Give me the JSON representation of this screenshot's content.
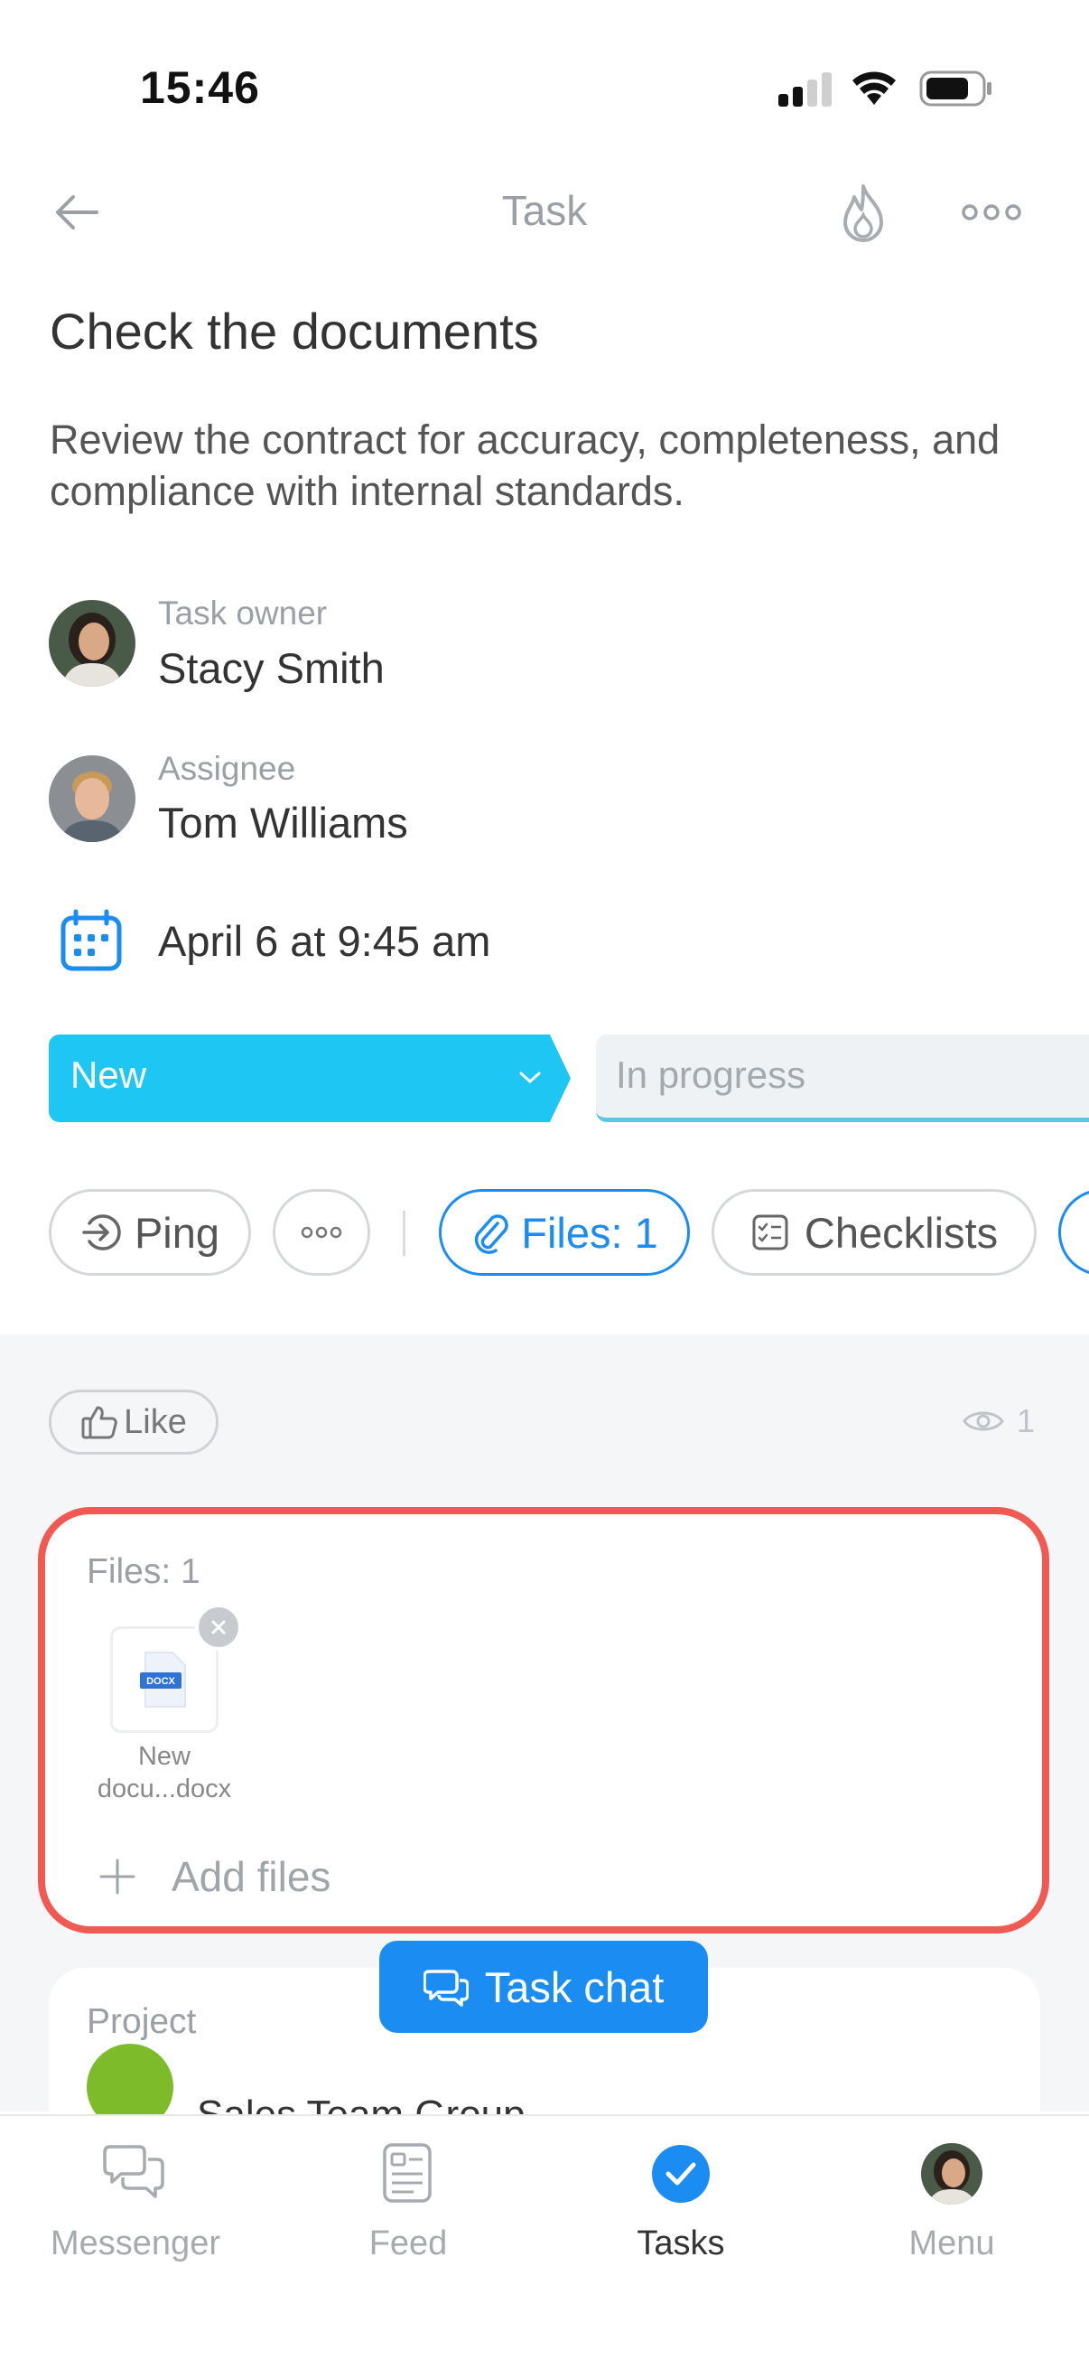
{
  "status_bar": {
    "time": "15:46"
  },
  "header": {
    "title": "Task",
    "back_icon": "arrow-left-icon",
    "fire_icon": "flame-icon",
    "more_icon": "more-horizontal-icon"
  },
  "task": {
    "title": "Check the documents",
    "description": "Review the contract for accuracy, completeness, and compliance with internal standards."
  },
  "owner": {
    "label": "Task owner",
    "name": "Stacy Smith"
  },
  "assignee": {
    "label": "Assignee",
    "name": "Tom Williams"
  },
  "deadline": {
    "text": "April 6 at 9:45 am"
  },
  "stages": {
    "current": "New",
    "next": "In progress",
    "current_color": "#1ec6f4"
  },
  "actions": {
    "ping": "Ping",
    "files": "Files: 1",
    "checklists": "Checklists"
  },
  "feed": {
    "like": "Like",
    "views": "1"
  },
  "files_card": {
    "label": "Files: 1",
    "file": {
      "type": "DOCX",
      "name_line1": "New",
      "name_line2": "docu...docx"
    },
    "add_files": "Add files",
    "highlight_color": "#f15a52"
  },
  "project_card": {
    "label": "Project",
    "name": "Sales Team Group"
  },
  "task_chat": {
    "label": "Task chat"
  },
  "bottom_nav": {
    "items": [
      {
        "label": "Messenger"
      },
      {
        "label": "Feed"
      },
      {
        "label": "Tasks"
      },
      {
        "label": "Menu"
      }
    ],
    "active": "Tasks"
  },
  "colors": {
    "accent": "#1a8cf2",
    "stage_new": "#1ec6f4",
    "highlight": "#f15a52"
  }
}
